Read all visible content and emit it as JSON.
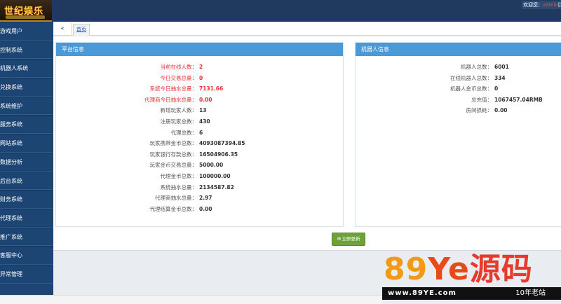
{
  "header": {
    "logo_text": "世纪娱乐",
    "welcome_prefix": "欢迎您：",
    "username": "admin",
    "welcome_suffix": "[退"
  },
  "sidebar": {
    "items": [
      {
        "label": "游戏用户"
      },
      {
        "label": "控制系统"
      },
      {
        "label": "机器人系统"
      },
      {
        "label": "兑换系统"
      },
      {
        "label": "系统维护"
      },
      {
        "label": "服务系统"
      },
      {
        "label": "网站系统"
      },
      {
        "label": "数据分析"
      },
      {
        "label": "后台系统"
      },
      {
        "label": "财务系统"
      },
      {
        "label": "代理系统"
      },
      {
        "label": "推广系统"
      },
      {
        "label": "客服中心"
      },
      {
        "label": "异常管理"
      }
    ]
  },
  "tabs": {
    "back_icon": "«",
    "home_label": "首页"
  },
  "platform_panel": {
    "title": "平台信息",
    "rows": [
      {
        "label": "当前在线人数：",
        "value": "2",
        "highlight": true
      },
      {
        "label": "今日交易总量：",
        "value": "0",
        "highlight": true
      },
      {
        "label": "系统今日抽水总量：",
        "value": "7131.66",
        "highlight": true
      },
      {
        "label": "代理商今日抽水总量：",
        "value": "0.00",
        "highlight": true
      },
      {
        "label": "新增玩家人数：",
        "value": "13",
        "highlight": false
      },
      {
        "label": "注册玩家总数：",
        "value": "430",
        "highlight": false
      },
      {
        "label": "代理总数：",
        "value": "6",
        "highlight": false
      },
      {
        "label": "玩家携带金币总数：",
        "value": "4093087394.85",
        "highlight": false
      },
      {
        "label": "玩家银行存款总数：",
        "value": "16504906.35",
        "highlight": false
      },
      {
        "label": "玩家金币交易总量：",
        "value": "5000.00",
        "highlight": false
      },
      {
        "label": "代理金币总数：",
        "value": "100000.00",
        "highlight": false
      },
      {
        "label": "系统抽水总量：",
        "value": "2134587.82",
        "highlight": false
      },
      {
        "label": "代理商抽水总量：",
        "value": "2.97",
        "highlight": false
      },
      {
        "label": "代理结算金币总数：",
        "value": "0.00",
        "highlight": false
      }
    ]
  },
  "robot_panel": {
    "title": "机器人信息",
    "rows": [
      {
        "label": "机器人总数：",
        "value": "6001"
      },
      {
        "label": "在线机器人总数：",
        "value": "334"
      },
      {
        "label": "机器人金币总数：",
        "value": "0"
      },
      {
        "label": "总充值：",
        "value": "1067457.04RMB"
      },
      {
        "label": "房间损耗：",
        "value": "0.00"
      }
    ]
  },
  "refresh_button": {
    "icon": "⊕",
    "label": "立即更新"
  },
  "watermark": {
    "n": "89",
    "y": "Ye",
    "h": "源码",
    "url": "www.89YE.com",
    "tag": "10年老站"
  },
  "colors": {
    "header_bg": "#1f3a5e",
    "sidebar_bg": "#1d4574",
    "panel_head_bg": "#4a9ad8",
    "highlight_red": "#e83030",
    "refresh_green": "#6da13a"
  }
}
